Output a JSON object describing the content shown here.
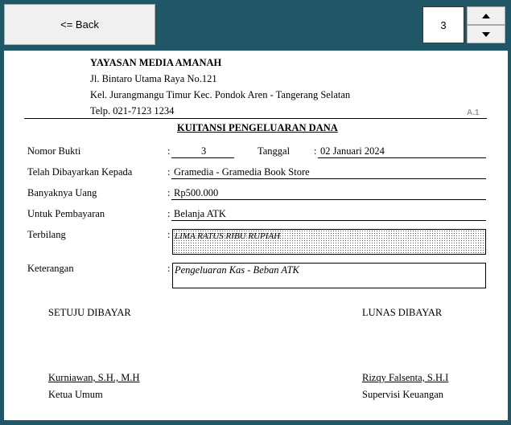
{
  "toolbar": {
    "back_label": "<= Back",
    "page_number": "3"
  },
  "header": {
    "org_name": "YAYASAN MEDIA AMANAH",
    "address_line1": "Jl. Bintaro Utama Raya No.121",
    "address_line2": "Kel. Jurangmangu Timur Kec. Pondok Aren - Tangerang Selatan",
    "phone": "Telp. 021-7123 1234",
    "form_code": "A.1"
  },
  "receipt": {
    "title": "KUITANSI PENGELUARAN DANA",
    "nomor_bukti_label": "Nomor Bukti",
    "nomor_bukti_value": "3",
    "tanggal_label": "Tanggal",
    "tanggal_value": "02 Januari 2024",
    "dibayarkan_label": "Telah Dibayarkan Kepada",
    "dibayarkan_value": "Gramedia - Gramedia Book Store",
    "uang_label": "Banyaknya Uang",
    "uang_value": "Rp500.000",
    "pembayaran_label": "Untuk Pembayaran",
    "pembayaran_value": "Belanja ATK",
    "terbilang_label": "Terbilang",
    "terbilang_value": "LIMA RATUS RIBU  RUPIAH",
    "keterangan_label": "Keterangan",
    "keterangan_value": "Pengeluaran Kas - Beban ATK",
    "colon": ":"
  },
  "signatures": {
    "left_heading": "SETUJU DIBAYAR",
    "left_name": "Kurniawan, S.H., M.H",
    "left_title": "Ketua Umum",
    "right_heading": "LUNAS DIBAYAR",
    "right_name": "Rizqy Falsenta, S.H.I",
    "right_title": "Supervisi Keuangan"
  }
}
